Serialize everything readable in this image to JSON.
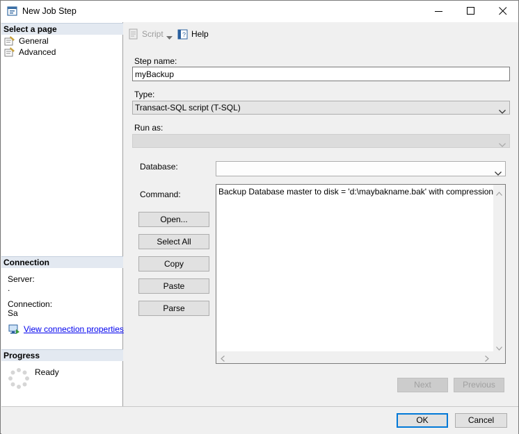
{
  "window": {
    "title": "New Job Step"
  },
  "left": {
    "select_page_header": "Select a page",
    "pages": [
      {
        "label": "General"
      },
      {
        "label": "Advanced"
      }
    ],
    "connection_header": "Connection",
    "server_label": "Server:",
    "server_value": ".",
    "connection_label": "Connection:",
    "connection_value": "Sa",
    "view_connection_link": "View connection properties",
    "progress_header": "Progress",
    "progress_status": "Ready"
  },
  "toolbar": {
    "script_label": "Script",
    "help_label": "Help"
  },
  "form": {
    "step_name_label": "Step name:",
    "step_name_value": "myBackup",
    "type_label": "Type:",
    "type_value": "Transact-SQL script (T-SQL)",
    "run_as_label": "Run as:",
    "run_as_value": "",
    "database_label": "Database:",
    "database_value": "",
    "command_label": "Command:",
    "command_text": "Backup Database master to disk = 'd:\\maybakname.bak' with compression",
    "open_button": "Open...",
    "select_all_button": "Select All",
    "copy_button": "Copy",
    "paste_button": "Paste",
    "parse_button": "Parse",
    "next_button": "Next",
    "previous_button": "Previous"
  },
  "footer": {
    "ok_button": "OK",
    "cancel_button": "Cancel"
  },
  "colors": {
    "accent": "#0078d7",
    "section_header_bg": "#e3e9f1",
    "link": "#0000ee"
  }
}
